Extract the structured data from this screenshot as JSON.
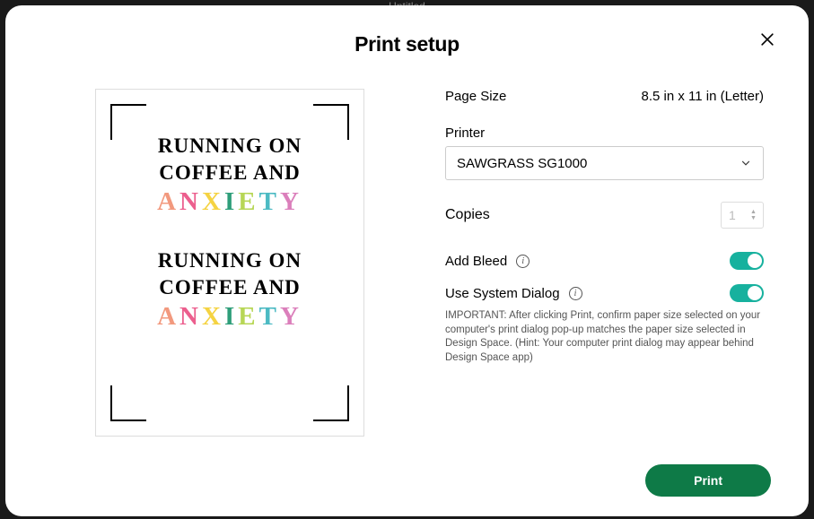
{
  "topbar": {
    "title": "Untitled"
  },
  "modal": {
    "title": "Print setup",
    "preview_lines": [
      "RUNNING ON",
      "COFFEE AND"
    ],
    "preview_color_word": "ANXIETY"
  },
  "settings": {
    "page_size_label": "Page Size",
    "page_size_value": "8.5 in x 11 in (Letter)",
    "printer_label": "Printer",
    "printer_value": "SAWGRASS SG1000",
    "copies_label": "Copies",
    "copies_value": "1",
    "bleed_label": "Add Bleed",
    "bleed_on": true,
    "system_dialog_label": "Use System Dialog",
    "system_dialog_on": true,
    "hint": "IMPORTANT: After clicking Print, confirm paper size selected on your computer's print dialog pop-up matches the paper size selected in Design Space. (Hint: Your computer print dialog may appear behind Design Space app)"
  },
  "footer": {
    "print_label": "Print"
  }
}
